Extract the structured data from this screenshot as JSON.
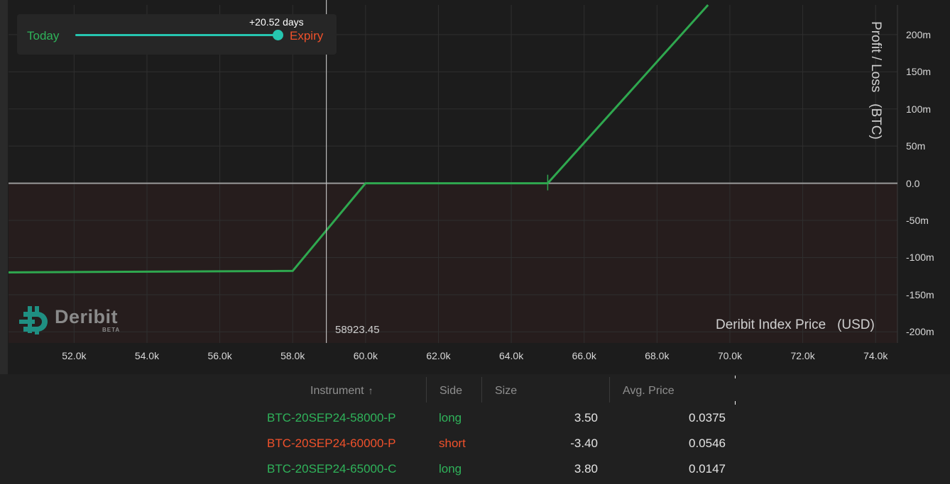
{
  "colors": {
    "profit_line": "#2fa84f",
    "long": "#2fb35a",
    "short": "#f0512b",
    "slider": "#26c6b0",
    "loss_zone": "#261d1d",
    "zero_line": "#9a9a9a"
  },
  "slider": {
    "left_label": "Today",
    "right_label": "Expiry",
    "days_offset": "+20.52 days",
    "position_fraction": 1.0
  },
  "brand": {
    "name": "Deribit",
    "tag": "BETA",
    "icon": "deribit-logo-icon"
  },
  "cursor": {
    "price": 58923.45,
    "price_label": "58923.45"
  },
  "chart_data": {
    "type": "line",
    "xlabel": "Deribit Index Price   (USD)",
    "ylabel": "Profit / Loss   (BTC)",
    "xlim": [
      50200,
      74600
    ],
    "ylim": [
      -215,
      240
    ],
    "x_ticks": [
      52000,
      54000,
      56000,
      58000,
      60000,
      62000,
      64000,
      66000,
      68000,
      70000,
      72000,
      74000
    ],
    "x_tick_labels": [
      "52.0k",
      "54.0k",
      "56.0k",
      "58.0k",
      "60.0k",
      "62.0k",
      "64.0k",
      "66.0k",
      "68.0k",
      "70.0k",
      "72.0k",
      "74.0k"
    ],
    "y_ticks": [
      200,
      150,
      100,
      50,
      0,
      -50,
      -100,
      -150,
      -200
    ],
    "y_tick_labels": [
      "200m",
      "150m",
      "100m",
      "50m",
      "0.0",
      "-50m",
      "-100m",
      "-150m",
      "-200m"
    ],
    "grid": true,
    "series": [
      {
        "x": [
          50200,
          58000,
          60000,
          65000,
          69400
        ],
        "y": [
          -120,
          -118,
          0,
          0,
          240
        ]
      }
    ],
    "markers": [
      {
        "x": 65000,
        "y": 0
      }
    ]
  },
  "table": {
    "columns": [
      {
        "label": "Instrument",
        "sort_icon": "↑"
      },
      {
        "label": "Side"
      },
      {
        "label": "Size"
      },
      {
        "label": "Avg. Price"
      }
    ],
    "rows": [
      {
        "instrument": "BTC-20SEP24-58000-P",
        "side": "long",
        "size": "3.50",
        "avg_price": "0.0375"
      },
      {
        "instrument": "BTC-20SEP24-60000-P",
        "side": "short",
        "size": "-3.40",
        "avg_price": "0.0546"
      },
      {
        "instrument": "BTC-20SEP24-65000-C",
        "side": "long",
        "size": "3.80",
        "avg_price": "0.0147"
      }
    ]
  }
}
